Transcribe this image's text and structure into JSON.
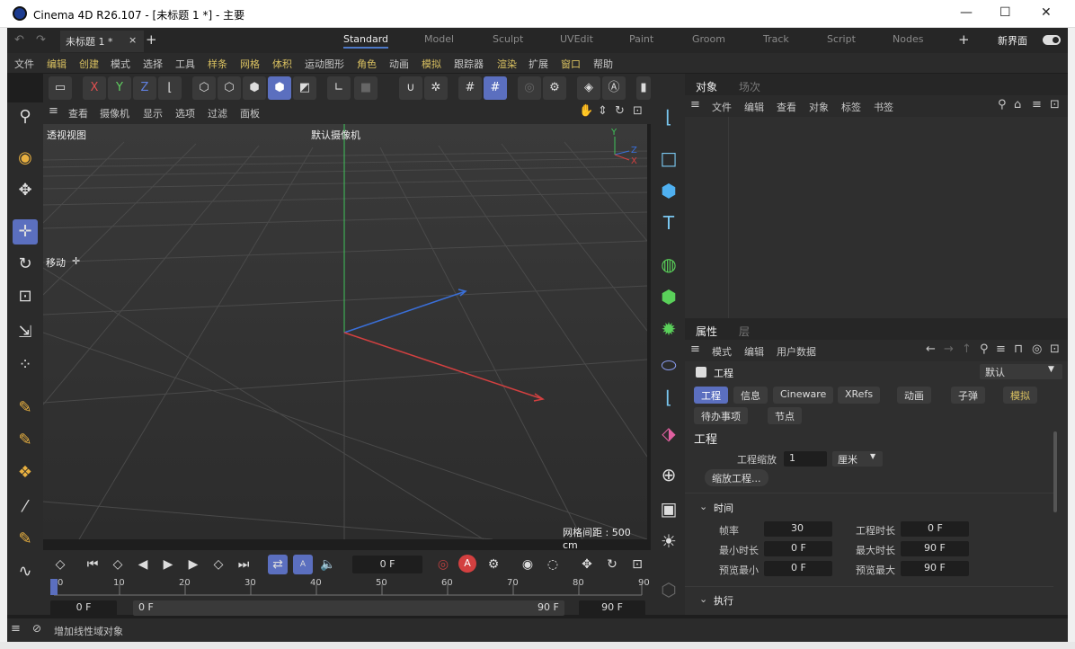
{
  "window": {
    "title": "Cinema 4D R26.107 - [未标题 1 *] - 主要",
    "minimize": "—",
    "maximize": "☐",
    "close": "✕"
  },
  "tabs": {
    "doc_tab": "未标题 1 *",
    "close": "×",
    "add": "+",
    "new_layout": "新界面"
  },
  "layouts": [
    "Standard",
    "Model",
    "Sculpt",
    "UVEdit",
    "Paint",
    "Groom",
    "Track",
    "Script",
    "Nodes"
  ],
  "menu": [
    "文件",
    "编辑",
    "创建",
    "模式",
    "选择",
    "工具",
    "样条",
    "网格",
    "体积",
    "运动图形",
    "角色",
    "动画",
    "模拟",
    "跟踪器",
    "渲染",
    "扩展",
    "窗口",
    "帮助"
  ],
  "toolbar": {
    "x": "X",
    "y": "Y",
    "z": "Z"
  },
  "viewport_menu": [
    "查看",
    "摄像机",
    "显示",
    "选项",
    "过滤",
    "面板"
  ],
  "viewport": {
    "name": "透视视图",
    "camera": "默认摄像机",
    "tool": "移动",
    "grid": "网格间距 : 500 cm",
    "axis_y": "Y",
    "axis_z": "Z",
    "axis_x": "X"
  },
  "object_panel": {
    "tabs": [
      "对象",
      "场次"
    ],
    "menu": [
      "文件",
      "编辑",
      "查看",
      "对象",
      "标签",
      "书签"
    ]
  },
  "attr_panel": {
    "tabs": [
      "属性",
      "层"
    ],
    "menu": [
      "模式",
      "编辑",
      "用户数据"
    ],
    "header": "工程",
    "preset": "默认",
    "chips": [
      "工程",
      "信息",
      "Cineware",
      "XRefs",
      "动画",
      "子弹",
      "模拟",
      "待办事项",
      "节点"
    ],
    "section": "工程",
    "scale_label": "工程缩放",
    "scale_value": "1",
    "scale_unit": "厘米",
    "scale_button": "缩放工程...",
    "time_section": "时间",
    "fps_label": "帧率",
    "fps_value": "30",
    "duration_label": "工程时长",
    "duration_value": "0 F",
    "min_label": "最小时长",
    "min_value": "0 F",
    "max_label": "最大时长",
    "max_value": "90 F",
    "pmin_label": "预览最小",
    "pmin_value": "0 F",
    "pmax_label": "预览最大",
    "pmax_value": "90 F",
    "exec_section": "执行"
  },
  "timeline": {
    "current": "0 F",
    "ticks": [
      "0",
      "10",
      "20",
      "30",
      "40",
      "50",
      "60",
      "70",
      "80",
      "90"
    ],
    "range_start": "0 F",
    "range_a": "0 F",
    "range_b": "90 F",
    "range_end": "90 F"
  },
  "status": {
    "text": "增加线性域对象"
  },
  "colors": {
    "accent": "#5b6fbf",
    "menu_highlight": "#d9c060",
    "axis_x": "#d34040",
    "axis_y": "#3fc45a",
    "axis_z": "#3a6fd8"
  }
}
